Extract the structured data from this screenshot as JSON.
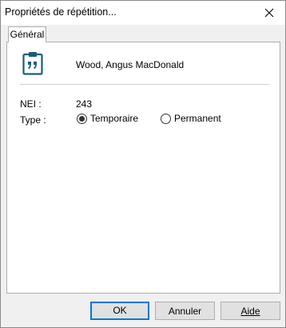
{
  "window": {
    "title": "Propriétés de répétition...",
    "close_glyph": "✕"
  },
  "tabs": [
    {
      "label": "Général",
      "selected": true
    }
  ],
  "header": {
    "icon": "clipboard-quote-icon",
    "name": "Wood, Angus MacDonald",
    "accent_color": "#1a5f73"
  },
  "fields": {
    "nei_label": "NEI :",
    "nei_value": "243",
    "type_label": "Type :"
  },
  "type_options": [
    {
      "label": "Temporaire",
      "selected": true
    },
    {
      "label": "Permanent",
      "selected": false
    }
  ],
  "buttons": {
    "ok": "OK",
    "cancel": "Annuler",
    "help": "Aide",
    "default_border_color": "#0078d7"
  }
}
